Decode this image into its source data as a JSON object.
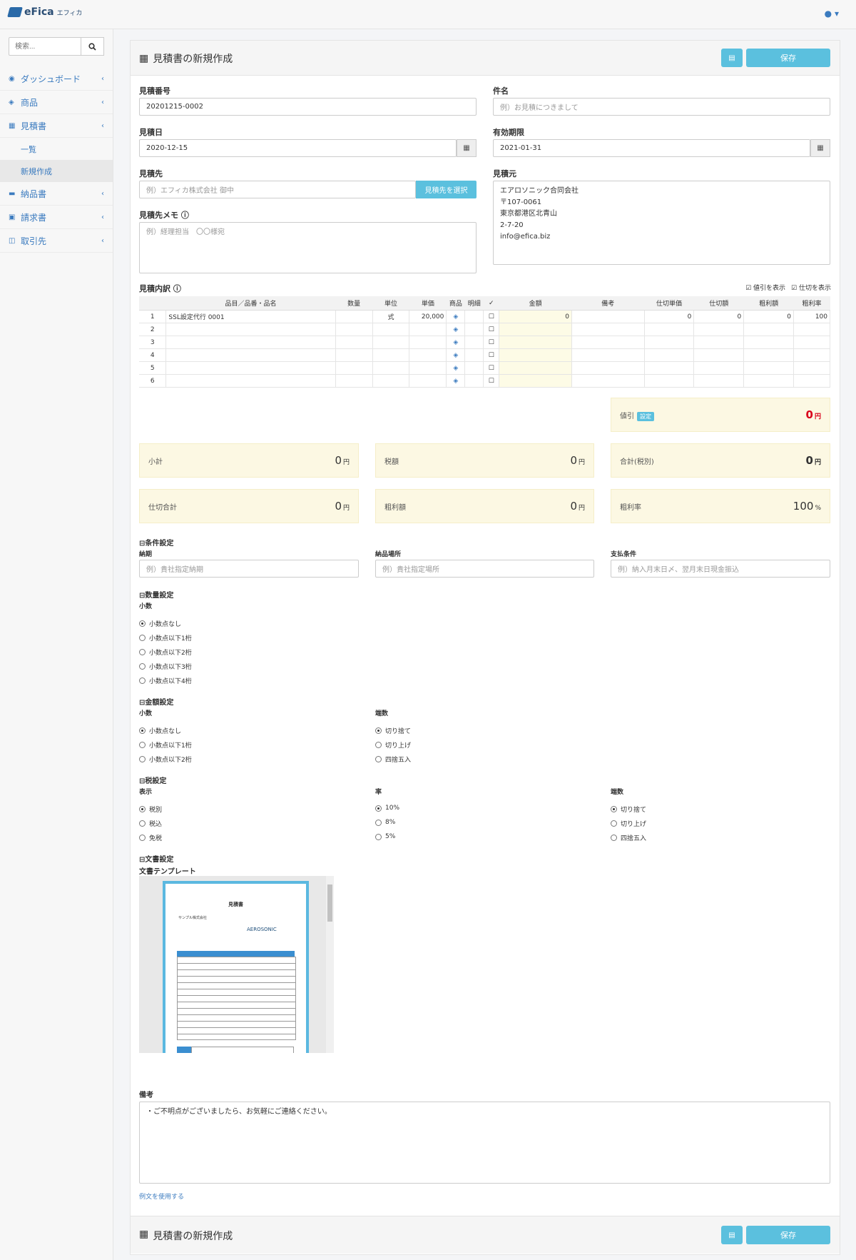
{
  "app": {
    "logo": "eFica",
    "logo_sub": "エフィカ",
    "user_icon": "user-icon"
  },
  "search": {
    "placeholder": "検索..."
  },
  "sidebar": {
    "items": [
      {
        "label": "ダッシュボード",
        "icon": "dashboard-icon"
      },
      {
        "label": "商品",
        "icon": "cube-icon"
      },
      {
        "label": "見積書",
        "icon": "calculator-icon"
      },
      {
        "label": "一覧"
      },
      {
        "label": "新規作成"
      },
      {
        "label": "納品書",
        "icon": "truck-icon"
      },
      {
        "label": "請求書",
        "icon": "money-icon"
      },
      {
        "label": "取引先",
        "icon": "book-icon"
      }
    ]
  },
  "page": {
    "title": "見積書の新規作成",
    "save_label": "保存"
  },
  "form": {
    "quote_no": {
      "label": "見積番号",
      "value": "20201215-0002"
    },
    "subject": {
      "label": "件名",
      "placeholder": "例）お見積につきまして"
    },
    "quote_date": {
      "label": "見積日",
      "value": "2020-12-15"
    },
    "valid_until": {
      "label": "有効期限",
      "value": "2021-01-31"
    },
    "client": {
      "label": "見積先",
      "placeholder": "例）エフィカ株式会社 御中",
      "button": "見積先を選択"
    },
    "issuer": {
      "label": "見積元",
      "lines": [
        "エアロソニック合同会社",
        "〒107-0061",
        "東京都港区北青山",
        "2-7-20",
        "info@efica.biz"
      ]
    },
    "client_memo": {
      "label": "見積先メモ",
      "placeholder": "例）経理担当　〇〇様宛"
    }
  },
  "items": {
    "label": "見積内訳",
    "show_discount": "値引を表示",
    "show_cost": "仕切を表示",
    "headers": [
      "品目／品番・品名",
      "数量",
      "単位",
      "単価",
      "商品",
      "明細",
      "✓",
      "金額",
      "備考",
      "仕切単価",
      "仕切額",
      "粗利額",
      "粗利率"
    ],
    "rows": [
      {
        "no": "1",
        "name": "SSL設定代行 0001",
        "unit": "式",
        "price": "20,000",
        "amount": "0",
        "cost_unit": "0",
        "cost": "0",
        "profit": "0",
        "rate": "100"
      },
      {
        "no": "2"
      },
      {
        "no": "3"
      },
      {
        "no": "4"
      },
      {
        "no": "5"
      },
      {
        "no": "6"
      }
    ]
  },
  "totals": {
    "discount": {
      "label": "値引",
      "badge": "設定",
      "value": "0",
      "unit": "円"
    },
    "subtotal": {
      "label": "小計",
      "value": "0",
      "unit": "円"
    },
    "tax": {
      "label": "税額",
      "value": "0",
      "unit": "円"
    },
    "total": {
      "label": "合計(税別)",
      "value": "0",
      "unit": "円"
    },
    "cost_total": {
      "label": "仕切合計",
      "value": "0",
      "unit": "円"
    },
    "profit": {
      "label": "粗利額",
      "value": "0",
      "unit": "円"
    },
    "profit_rate": {
      "label": "粗利率",
      "value": "100",
      "unit": "%"
    }
  },
  "conditions": {
    "title": "条件設定",
    "delivery": {
      "label": "納期",
      "placeholder": "例）貴社指定納期"
    },
    "place": {
      "label": "納品場所",
      "placeholder": "例）貴社指定場所"
    },
    "payment": {
      "label": "支払条件",
      "placeholder": "例）納入月末日〆、翌月末日現金振込"
    }
  },
  "quantity": {
    "title": "数量設定",
    "sub": "小数",
    "options": [
      "小数点なし",
      "小数点以下1桁",
      "小数点以下2桁",
      "小数点以下3桁",
      "小数点以下4桁"
    ]
  },
  "amount": {
    "title": "金額設定",
    "sub1": "小数",
    "opts1": [
      "小数点なし",
      "小数点以下1桁",
      "小数点以下2桁"
    ],
    "sub2": "端数",
    "opts2": [
      "切り捨て",
      "切り上げ",
      "四捨五入"
    ]
  },
  "tax": {
    "title": "税設定",
    "sub1": "表示",
    "opts1": [
      "税別",
      "税込",
      "免税"
    ],
    "sub2": "率",
    "opts2": [
      "10%",
      "8%",
      "5%"
    ],
    "sub3": "端数",
    "opts3": [
      "切り捨て",
      "切り上げ",
      "四捨五入"
    ]
  },
  "document": {
    "title": "文書設定",
    "sub": "文書テンプレート",
    "preview": {
      "heading": "見積書",
      "to": "サンプル株式会社",
      "brand": "AEROSONIC"
    }
  },
  "remarks": {
    "label": "備考",
    "value": "・ご不明点がございましたら、お気軽にご連絡ください。",
    "link": "例文を使用する"
  }
}
